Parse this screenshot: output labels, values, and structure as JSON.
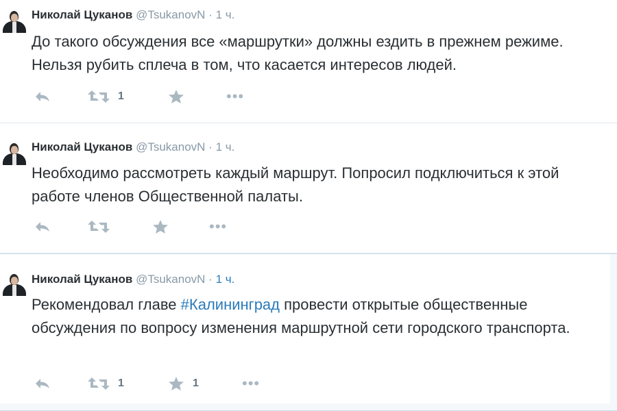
{
  "colors": {
    "name": "#292f33",
    "meta": "#8899a6",
    "link": "#2b7bb9",
    "icon": "#aab8c2"
  },
  "tweets": [
    {
      "author_name": "Николай Цуканов",
      "author_handle": "@TsukanovN",
      "separator": "·",
      "time": "1 ч.",
      "text": "До такого обсуждения все «маршрутки» должны ездить в прежнем режиме. Нельзя рубить сплеча в том, что касается интересов людей.",
      "retweet_count": "1",
      "favorite_count": ""
    },
    {
      "author_name": "Николай Цуканов",
      "author_handle": "@TsukanovN",
      "separator": "·",
      "time": "1 ч.",
      "text": "Необходимо рассмотреть каждый маршрут. Попросил подключиться к этой работе членов Общественной палаты.",
      "retweet_count": "",
      "favorite_count": ""
    },
    {
      "author_name": "Николай Цуканов",
      "author_handle": "@TsukanovN",
      "separator": "·",
      "time": "1 ч.",
      "text_before": "Рекомендовал главе ",
      "hashtag": "#Калининград",
      "text_after": " провести открытые общественные обсуждения по вопросу изменения маршрутной сети городского транспорта.",
      "retweet_count": "1",
      "favorite_count": "1"
    }
  ],
  "icons": {
    "reply": "reply-icon",
    "retweet": "retweet-icon",
    "favorite": "star-icon",
    "more": "more-icon"
  },
  "more_label": "•••"
}
